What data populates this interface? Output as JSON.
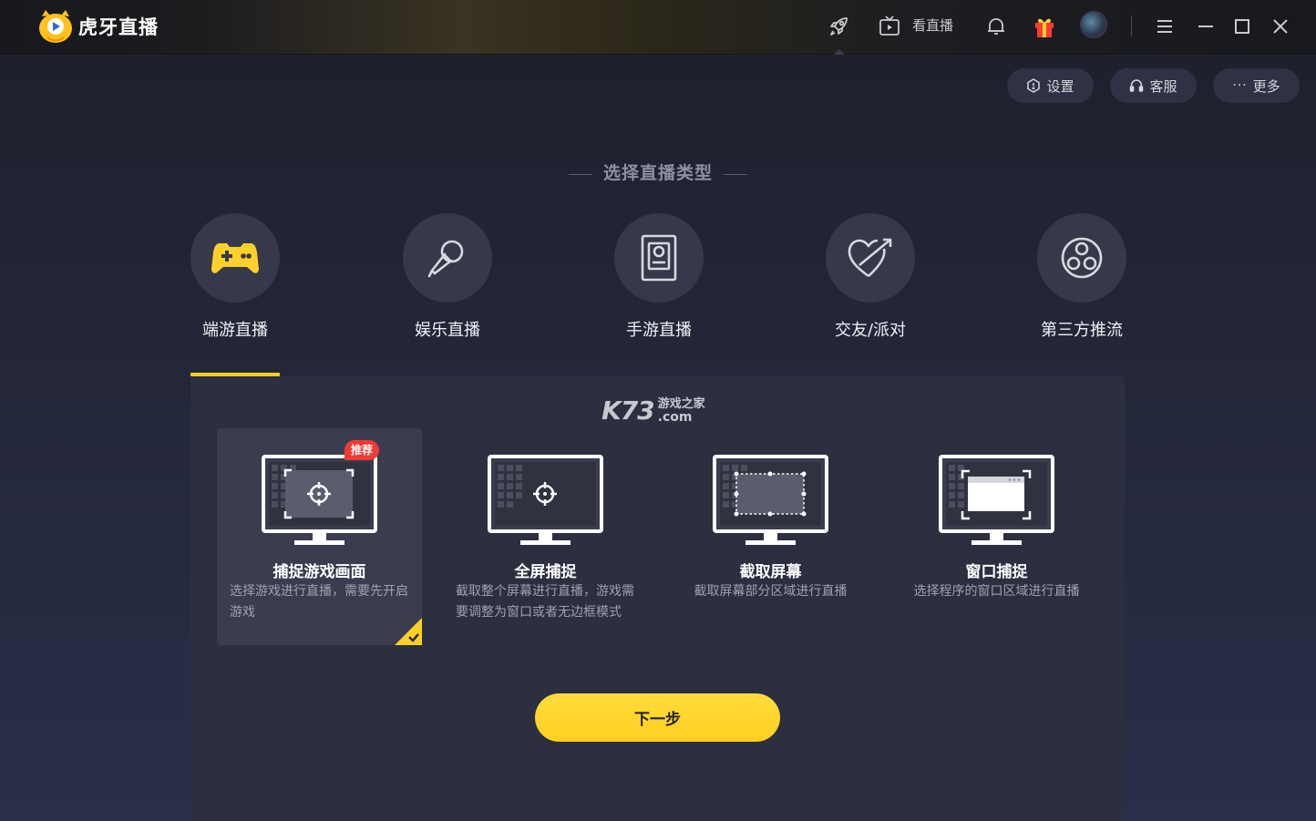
{
  "app": {
    "name": "虎牙直播"
  },
  "titlebar": {
    "watch_live_label": "看直播",
    "icons": [
      "rocket-icon",
      "tv-icon",
      "bell-icon",
      "gift-icon",
      "avatar",
      "menu-icon",
      "minimize-icon",
      "maximize-icon",
      "close-icon"
    ]
  },
  "toolbar": {
    "settings_label": "设置",
    "support_label": "客服",
    "more_label": "更多"
  },
  "section": {
    "title": "选择直播类型"
  },
  "categories": [
    {
      "label": "端游直播",
      "icon": "gamepad-icon",
      "selected": true
    },
    {
      "label": "娱乐直播",
      "icon": "microphone-icon",
      "selected": false
    },
    {
      "label": "手游直播",
      "icon": "phone-icon",
      "selected": false
    },
    {
      "label": "交友/派对",
      "icon": "heart-arrow-icon",
      "selected": false
    },
    {
      "label": "第三方推流",
      "icon": "obs-icon",
      "selected": false
    }
  ],
  "watermark": {
    "brand": "K73",
    "cn": "游戏之家",
    "domain": ".com"
  },
  "capture_options": [
    {
      "title": "捕捉游戏画面",
      "desc": "选择游戏进行直播，需要先开启游戏",
      "badge": "推荐",
      "selected": true
    },
    {
      "title": "全屏捕捉",
      "desc": "截取整个屏幕进行直播，游戏需要调整为窗口或者无边框模式",
      "selected": false
    },
    {
      "title": "截取屏幕",
      "desc": "截取屏幕部分区域进行直播",
      "selected": false
    },
    {
      "title": "窗口捕捉",
      "desc": "选择程序的窗口区域进行直播",
      "selected": false
    }
  ],
  "actions": {
    "next_label": "下一步"
  },
  "colors": {
    "accent": "#ffcf26",
    "badge": "#ee3b34",
    "panel": "#2c2f40"
  }
}
